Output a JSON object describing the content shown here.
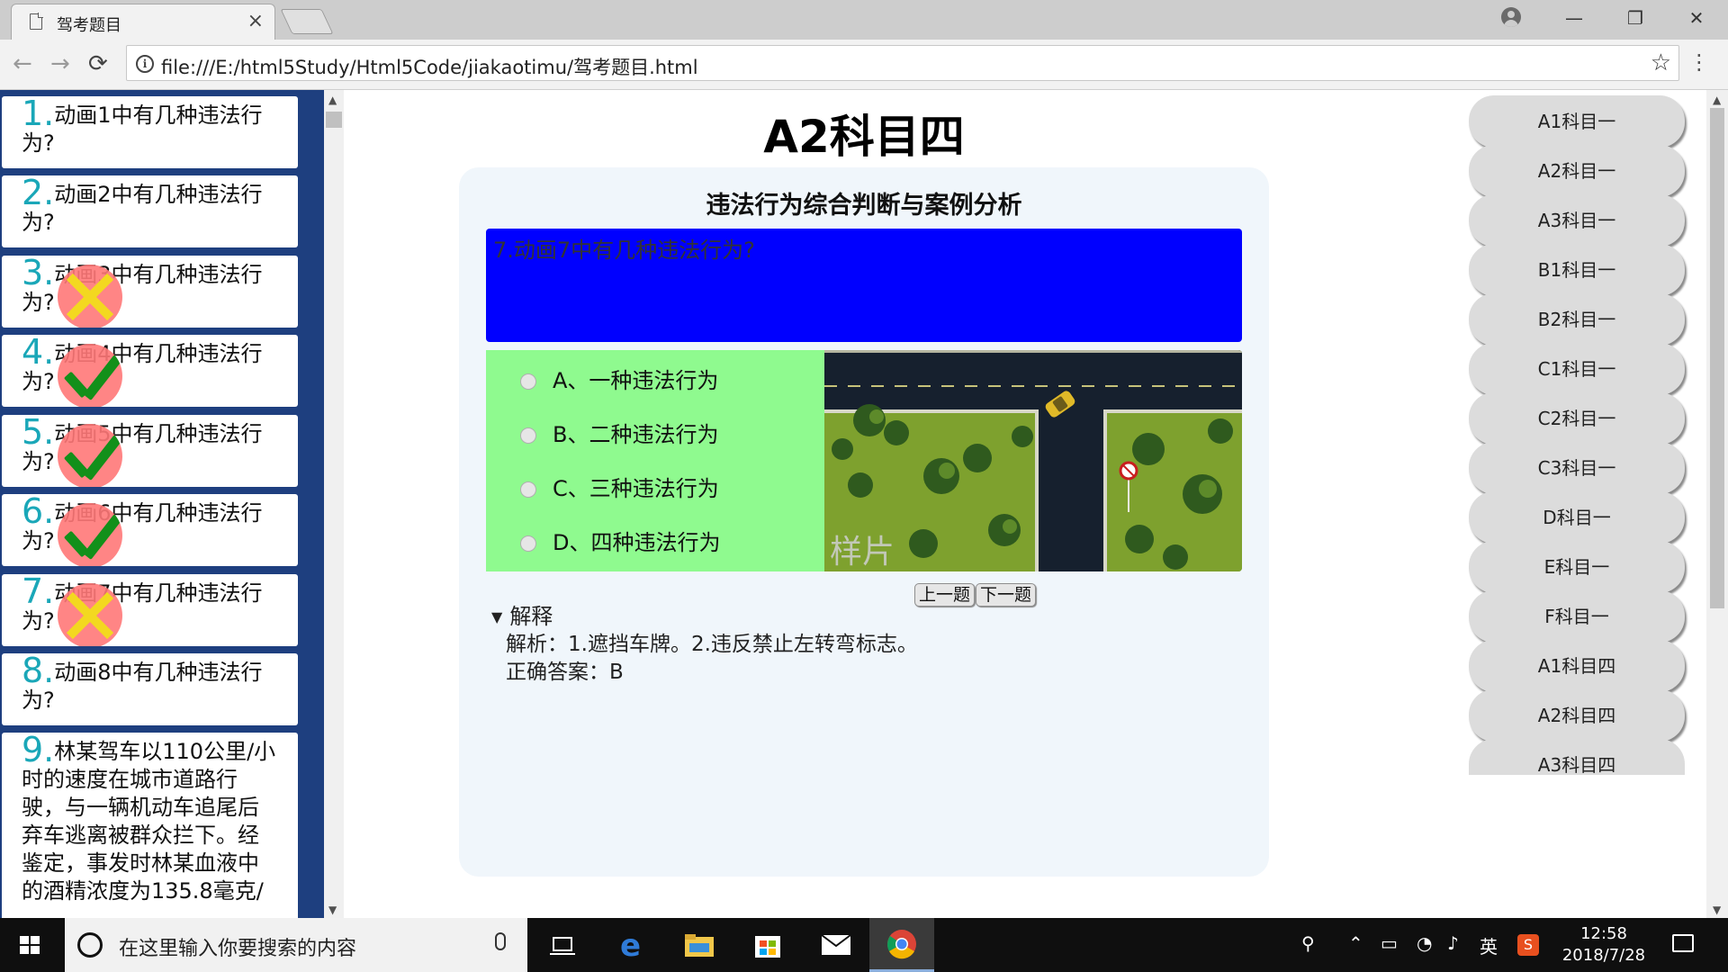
{
  "browser": {
    "tab_title": "驾考题目",
    "tab_close": "×",
    "url": "file:///E:/html5Study/Html5Code/jiakaotimu/驾考题目.html",
    "window_controls": {
      "minimize": "—",
      "restore": "❐",
      "close": "✕"
    },
    "nav": {
      "back": "←",
      "forward": "→",
      "reload": "⟳"
    },
    "star": "☆"
  },
  "questions": [
    {
      "num": "1.",
      "text": "动画1中有几种违法行为?",
      "mark": "none"
    },
    {
      "num": "2.",
      "text": "动画2中有几种违法行为?",
      "mark": "none"
    },
    {
      "num": "3.",
      "text": "动画3中有几种违法行为?",
      "mark": "wrong"
    },
    {
      "num": "4.",
      "text": "动画4中有几种违法行为?",
      "mark": "right"
    },
    {
      "num": "5.",
      "text": "动画5中有几种违法行为?",
      "mark": "right"
    },
    {
      "num": "6.",
      "text": "动画6中有几种违法行为?",
      "mark": "right"
    },
    {
      "num": "7.",
      "text": "动画7中有几种违法行为?",
      "mark": "wrong"
    },
    {
      "num": "8.",
      "text": "动画8中有几种违法行为?",
      "mark": "none"
    },
    {
      "num": "9.",
      "text": "林某驾车以110公里/小时的速度在城市道路行驶，与一辆机动车追尾后弃车逃离被群众拦下。经鉴定，事发时林某血液中的酒精浓度为135.8毫克/",
      "mark": "none"
    }
  ],
  "main": {
    "title": "A2科目四",
    "section_title": "违法行为综合判断与案例分析",
    "question_text": "7.动画7中有几种违法行为?",
    "options": [
      "A、一种违法行为",
      "B、二种违法行为",
      "C、三种违法行为",
      "D、四种违法行为"
    ],
    "watermark": "样片",
    "prev_label": "上一题",
    "next_label": "下一题",
    "details": {
      "triangle": "▼",
      "summary": "解释",
      "analysis": "解析：1.遮挡车牌。2.违反禁止左转弯标志。",
      "answer": "正确答案：B"
    }
  },
  "categories": [
    "A1科目一",
    "A2科目一",
    "A3科目一",
    "B1科目一",
    "B2科目一",
    "C1科目一",
    "C2科目一",
    "C3科目一",
    "D科目一",
    "E科目一",
    "F科目一",
    "A1科目四",
    "A2科目四",
    "A3科目四"
  ],
  "taskbar": {
    "search_placeholder": "在这里输入你要搜索的内容",
    "ime": "英",
    "time": "12:58",
    "date": "2018/7/28"
  },
  "colors": {
    "left_panel": "#1e3f7f",
    "question_bar": "#0000ff",
    "options_bg": "#8ffa8f",
    "card_bg": "#f0f6fb"
  }
}
